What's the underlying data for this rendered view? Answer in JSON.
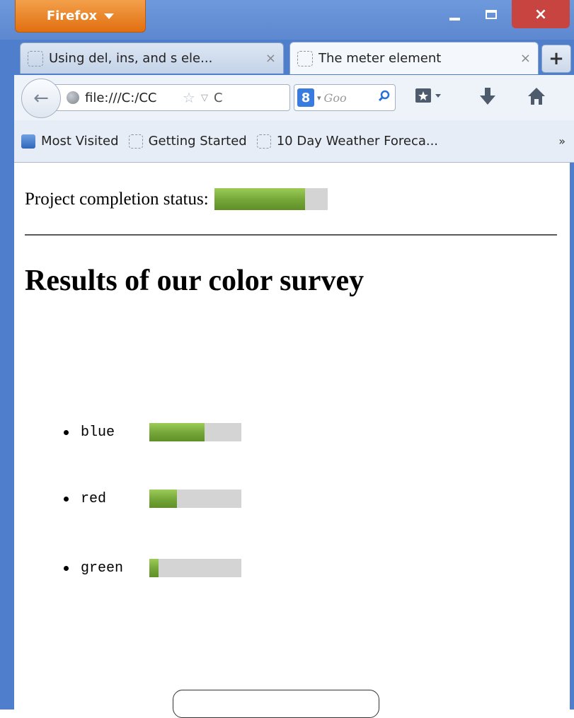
{
  "browser": {
    "menu_button": "Firefox",
    "tabs": [
      {
        "title": "Using del, ins, and s ele...",
        "close": "×",
        "active": false
      },
      {
        "title": "The meter element",
        "close": "×",
        "active": true
      }
    ],
    "new_tab": "+",
    "window_close": "×",
    "address": {
      "url": "file:///C:/CC",
      "star": "☆",
      "dropdown": "▽",
      "reload": "C"
    },
    "search": {
      "engine": "8",
      "placeholder": "Goo",
      "go": "⚲"
    },
    "bookmarks": [
      {
        "label": "Most Visited",
        "icon": "most-visited-icon"
      },
      {
        "label": "Getting Started",
        "icon": "blank-page-icon"
      },
      {
        "label": "10 Day Weather Foreca...",
        "icon": "blank-page-icon"
      }
    ],
    "bookmarks_more": "»",
    "colors": {
      "frame": "#4f7fcc",
      "firefox_button": "#e67d1f",
      "close_button": "#c84440",
      "meter_fill": "#77a83a",
      "meter_track": "#d4d4d4"
    }
  },
  "page": {
    "status_label": "Project completion status:",
    "project_completion": 0.8,
    "heading": "Results of our color survey",
    "survey": [
      {
        "color": "blue",
        "value": 0.6
      },
      {
        "color": "red",
        "value": 0.3
      },
      {
        "color": "green",
        "value": 0.1
      }
    ]
  }
}
